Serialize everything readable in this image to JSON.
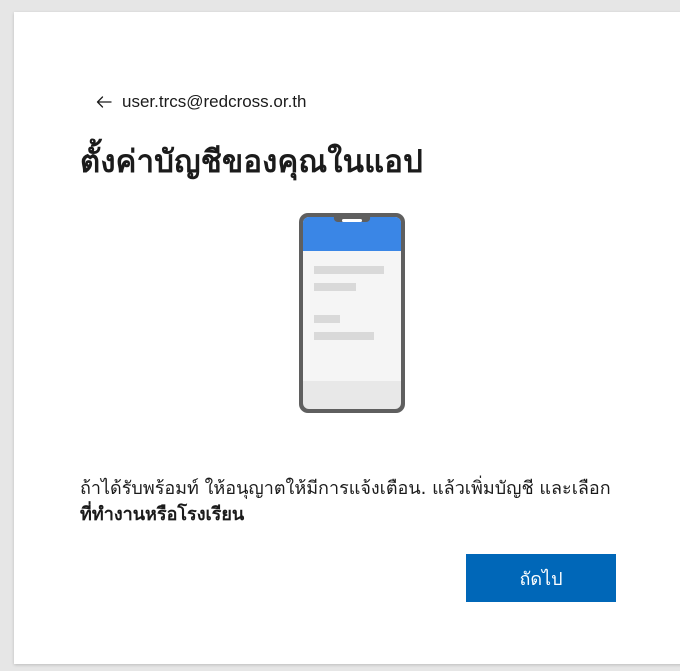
{
  "account": {
    "email": "user.trcs@redcross.or.th",
    "back_icon": "arrow-left-icon"
  },
  "title": "ตั้งค่าบัญชีของคุณในแอป",
  "illustration": {
    "icon": "phone-icon",
    "accent_color": "#3a86e6",
    "frame_color": "#5f5f5f"
  },
  "instructions": {
    "text_part1": "ถ้าได้รับพร้อมท์ ให้อนุญาตให้มีการแจ้งเตือน. แล้วเพิ่มบัญชี และเลือก ",
    "text_bold": "ที่ทำงานหรือโรงเรียน"
  },
  "buttons": {
    "next_label": "ถัดไป",
    "primary_color": "#0067b8"
  }
}
